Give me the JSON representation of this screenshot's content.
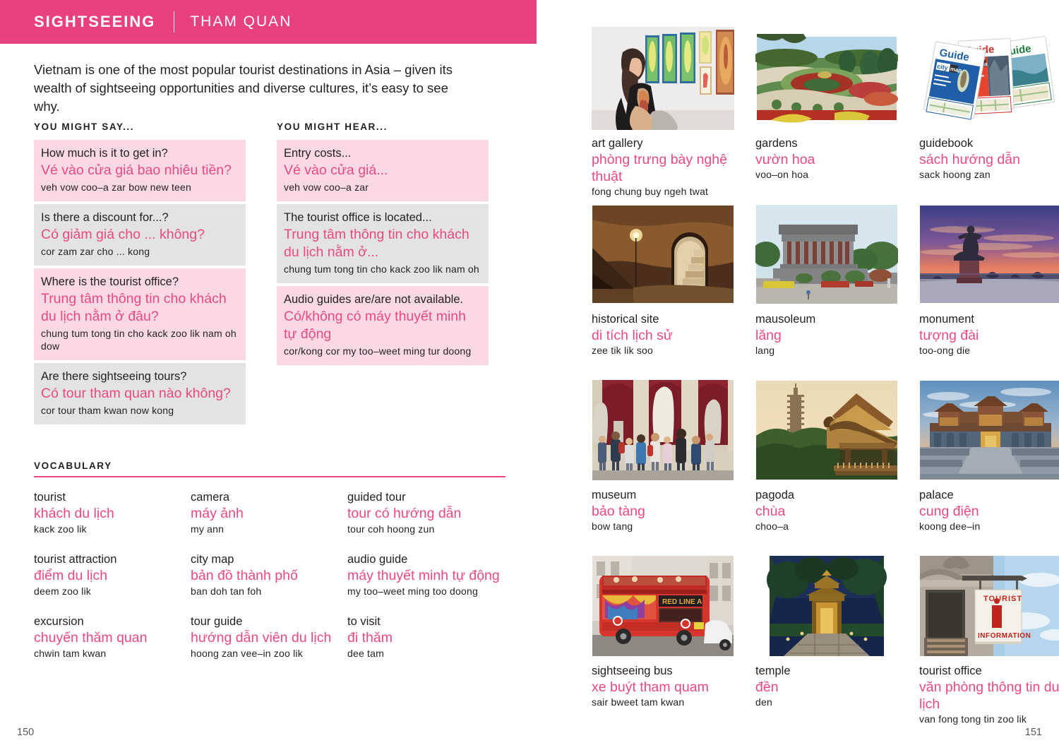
{
  "header": {
    "title": "SIGHTSEEING",
    "subtitle": "THAM QUAN"
  },
  "intro": "Vietnam is one of the most popular tourist destinations in Asia – given its wealth of sightseeing opportunities and diverse cultures, it’s easy to see why.",
  "colors": {
    "accent_pink": "#e9417f",
    "text_pink": "#ec4980",
    "box_pink": "#fbd9e2",
    "box_grey": "#e3e3e3",
    "body_text": "#231f20"
  },
  "you_might_say": {
    "heading": "YOU MIGHT SAY...",
    "items": [
      {
        "tone": "pink",
        "en": "How much is it to get in?",
        "vn": "Vé vào cửa giá bao nhiêu tiền?",
        "pron": "veh vow coo–a zar bow new teen"
      },
      {
        "tone": "grey",
        "en": "Is there a discount for...?",
        "vn": "Có giảm giá cho ... không?",
        "pron": "cor zam zar cho ... kong"
      },
      {
        "tone": "pink",
        "en": "Where is the tourist office?",
        "vn": "Trung tâm thông tin cho khách du lịch nằm ở đâu?",
        "pron": "chung tum tong tin cho kack zoo lik nam oh dow"
      },
      {
        "tone": "grey",
        "en": "Are there sightseeing tours?",
        "vn": "Có tour tham quan nào không?",
        "pron": "cor tour tham kwan now kong"
      }
    ]
  },
  "you_might_hear": {
    "heading": "YOU MIGHT HEAR...",
    "items": [
      {
        "tone": "pink",
        "en": "Entry costs...",
        "vn": "Vé vào cửa giá...",
        "pron": "veh vow coo–a zar"
      },
      {
        "tone": "grey",
        "en": "The tourist office is located...",
        "vn": "Trung tâm thông tin cho khách du lịch nằm ở...",
        "pron": "chung tum tong tin cho kack zoo lik nam oh"
      },
      {
        "tone": "pink",
        "en": "Audio guides are/are not available.",
        "vn": "Có/không có máy thuyết minh tự động",
        "pron": "cor/kong cor my too–weet ming tur doong"
      }
    ]
  },
  "vocabulary": {
    "heading": "VOCABULARY",
    "columns": [
      [
        {
          "en": "tourist",
          "vn": "khách du lịch",
          "pron": "kack zoo lik"
        },
        {
          "en": "tourist attraction",
          "vn": "điểm du lịch",
          "pron": "deem zoo lik"
        },
        {
          "en": "excursion",
          "vn": "chuyến thăm quan",
          "pron": "chwin tam kwan"
        }
      ],
      [
        {
          "en": "camera",
          "vn": "máy ảnh",
          "pron": "my ann"
        },
        {
          "en": "city map",
          "vn": "bản đồ thành phố",
          "pron": "ban doh tan foh"
        },
        {
          "en": "tour guide",
          "vn": "hướng dẫn viên du lịch",
          "pron": "hoong zan vee–in zoo lik"
        }
      ],
      [
        {
          "en": "guided tour",
          "vn": "tour có hướng dẫn",
          "pron": "tour coh hoong zun"
        },
        {
          "en": "audio guide",
          "vn": "máy thuyết minh tự động",
          "pron": "my too–weet ming too doong"
        },
        {
          "en": "to visit",
          "vn": "đi thăm",
          "pron": "dee tam"
        }
      ]
    ]
  },
  "picture_grid": [
    {
      "image": "art-gallery-photo",
      "en": "art gallery",
      "vn": "phòng trưng bày nghệ thuật",
      "pron": "fong chung buy ngeh twat"
    },
    {
      "image": "gardens-photo",
      "en": "gardens",
      "vn": "vườn hoa",
      "pron": "voo–on hoa"
    },
    {
      "image": "guidebook-photo",
      "en": "guidebook",
      "vn": "sách hướng dẫn",
      "pron": "sack hoong zan"
    },
    {
      "image": "historical-site-photo",
      "en": "historical site",
      "vn": "di tích lịch sử",
      "pron": "zee tik lik soo"
    },
    {
      "image": "mausoleum-photo",
      "en": "mausoleum",
      "vn": "lăng",
      "pron": "lang"
    },
    {
      "image": "monument-photo",
      "en": "monument",
      "vn": "tượng đài",
      "pron": "too-ong die"
    },
    {
      "image": "museum-photo",
      "en": "museum",
      "vn": "bảo tàng",
      "pron": "bow tang"
    },
    {
      "image": "pagoda-photo",
      "en": "pagoda",
      "vn": "chùa",
      "pron": "choo–a"
    },
    {
      "image": "palace-photo",
      "en": "palace",
      "vn": "cung điện",
      "pron": "koong dee–in"
    },
    {
      "image": "sightseeing-bus-photo",
      "en": "sightseeing bus",
      "vn": "xe buýt tham quam",
      "pron": "sair bweet tam kwan"
    },
    {
      "image": "temple-photo",
      "en": "temple",
      "vn": "đền",
      "pron": "den"
    },
    {
      "image": "tourist-office-photo",
      "en": "tourist office",
      "vn": "văn phòng thông tin du lịch",
      "pron": "van fong tong tin zoo lik"
    }
  ],
  "guidebook_labels": {
    "guide": "Guide",
    "city_map": "city map"
  },
  "bus_label": "RED LINE A",
  "tourist_sign": {
    "top": "TOURIST",
    "letter": "i",
    "bottom": "INFORMATION"
  },
  "folio": {
    "left": "150",
    "right": "151"
  }
}
